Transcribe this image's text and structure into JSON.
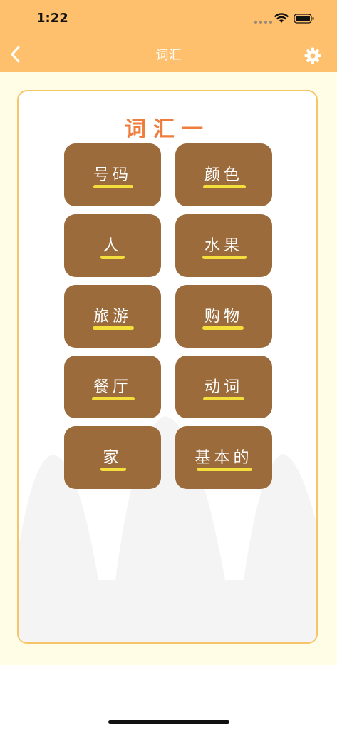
{
  "status_bar": {
    "time": "1:22"
  },
  "nav": {
    "title": "词汇",
    "back_icon": "chevron-left-icon",
    "settings_icon": "gear-icon"
  },
  "card": {
    "title": "词汇一",
    "tiles": [
      {
        "label": "号码"
      },
      {
        "label": "颜色"
      },
      {
        "label": "人"
      },
      {
        "label": "水果"
      },
      {
        "label": "旅游"
      },
      {
        "label": "购物"
      },
      {
        "label": "餐厅"
      },
      {
        "label": "动词"
      },
      {
        "label": "家"
      },
      {
        "label": "基本的"
      }
    ]
  },
  "colors": {
    "header": "#fec06c",
    "background": "#fffde6",
    "card_border": "#f6c56a",
    "title": "#ef7d3d",
    "tile": "#9c6b3c",
    "underline": "#f4de3b"
  }
}
